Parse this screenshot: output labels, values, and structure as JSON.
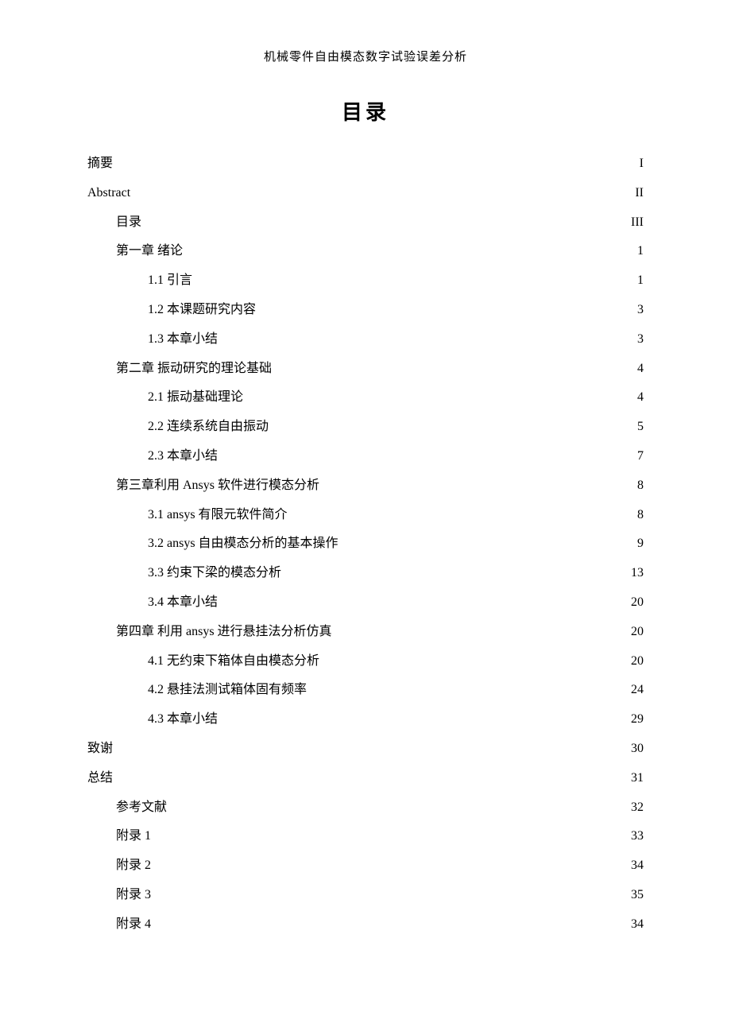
{
  "header": {
    "running_title": "机械零件自由模态数字试验误差分析"
  },
  "toc": {
    "title": "目录",
    "entries": [
      {
        "level": 0,
        "label": "摘要",
        "page": "I"
      },
      {
        "level": 0,
        "label": "Abstract",
        "page": "II"
      },
      {
        "level": 1,
        "label": "目录",
        "page": "III"
      },
      {
        "level": 1,
        "label": "第一章 绪论",
        "page": "1"
      },
      {
        "level": 2,
        "label": "1.1 引言",
        "page": "1"
      },
      {
        "level": 2,
        "label": "1.2 本课题研究内容",
        "page": "3"
      },
      {
        "level": 2,
        "label": "1.3 本章小结",
        "page": "3"
      },
      {
        "level": 1,
        "label": "第二章 振动研究的理论基础",
        "page": "4"
      },
      {
        "level": 2,
        "label": "2.1 振动基础理论",
        "page": "4"
      },
      {
        "level": 2,
        "label": "2.2 连续系统自由振动",
        "page": "5"
      },
      {
        "level": 2,
        "label": "2.3 本章小结",
        "page": "7"
      },
      {
        "level": 1,
        "label": "第三章利用 Ansys 软件进行模态分析",
        "page": "8"
      },
      {
        "level": 2,
        "label": "3.1 ansys 有限元软件简介",
        "page": "8"
      },
      {
        "level": 2,
        "label": "3.2 ansys 自由模态分析的基本操作",
        "page": "9"
      },
      {
        "level": 2,
        "label": "3.3 约束下梁的模态分析",
        "page": "13"
      },
      {
        "level": 2,
        "label": "3.4 本章小结",
        "page": "20"
      },
      {
        "level": 1,
        "label": "第四章 利用 ansys 进行悬挂法分析仿真",
        "page": "20"
      },
      {
        "level": 2,
        "label": "4.1 无约束下箱体自由模态分析",
        "page": "20"
      },
      {
        "level": 2,
        "label": "4.2 悬挂法测试箱体固有频率",
        "page": "24"
      },
      {
        "level": 2,
        "label": "4.3 本章小结",
        "page": "29"
      },
      {
        "level": 0,
        "label": "致谢",
        "page": "30"
      },
      {
        "level": 0,
        "label": "总结",
        "page": "31"
      },
      {
        "level": 1,
        "label": "参考文献",
        "page": "32"
      },
      {
        "level": 1,
        "label": "附录 1",
        "page": "33"
      },
      {
        "level": 1,
        "label": "附录 2",
        "page": "34"
      },
      {
        "level": 1,
        "label": "附录 3",
        "page": "35"
      },
      {
        "level": 1,
        "label": "附录 4",
        "page": "34"
      }
    ]
  }
}
